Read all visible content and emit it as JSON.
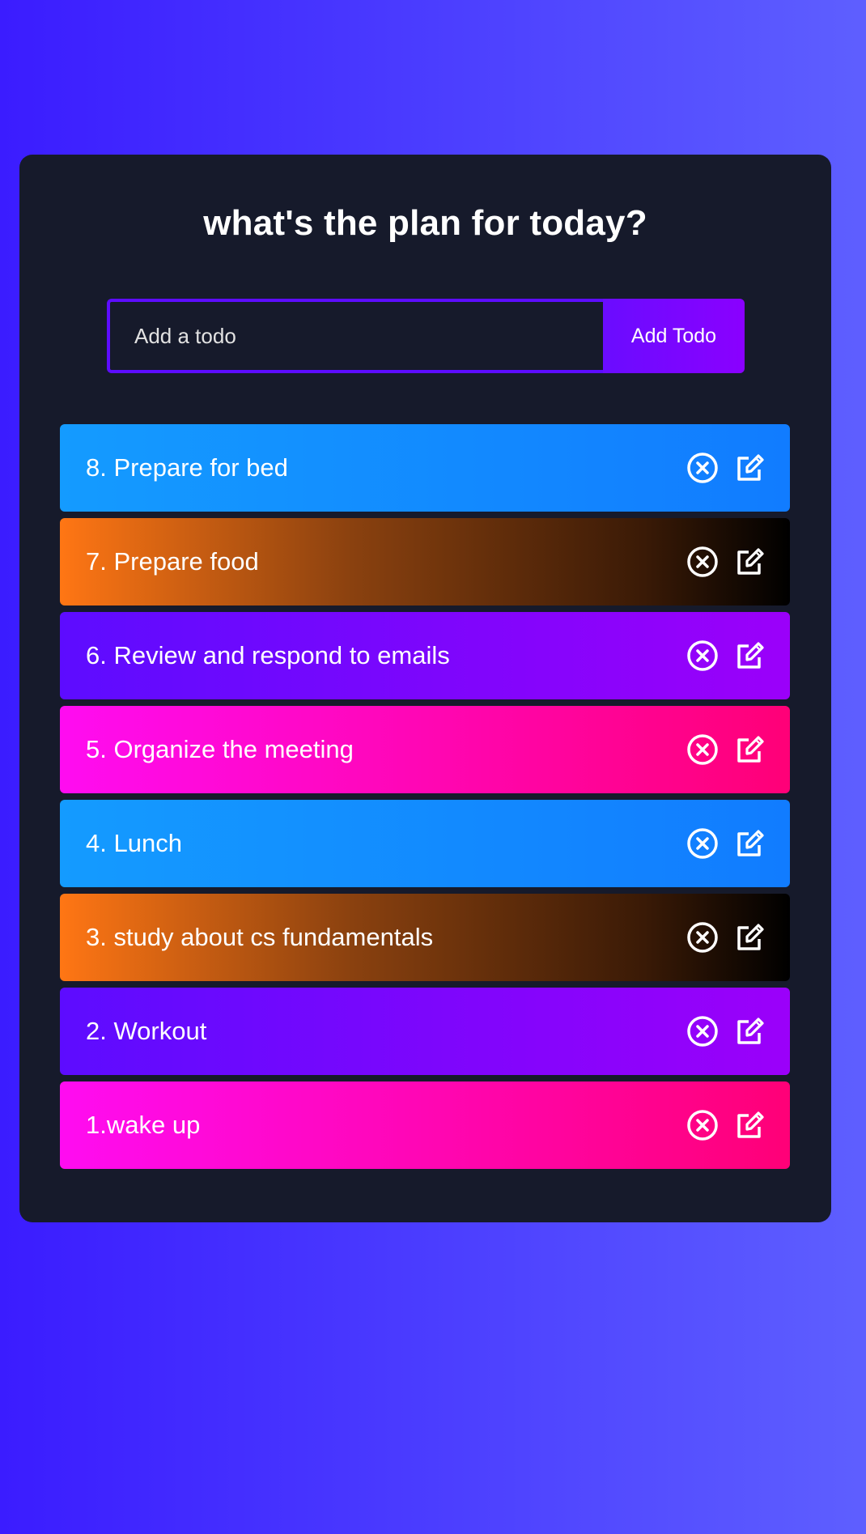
{
  "app": {
    "title": "what's the plan for today?"
  },
  "form": {
    "input_placeholder": "Add a todo",
    "input_value": "",
    "button_label": "Add Todo"
  },
  "todos": [
    {
      "text": "8. Prepare for bed",
      "theme": "blue"
    },
    {
      "text": "7. Prepare food",
      "theme": "orange"
    },
    {
      "text": "6. Review and respond to emails",
      "theme": "purple"
    },
    {
      "text": "5. Organize the meeting",
      "theme": "pink"
    },
    {
      "text": "4. Lunch",
      "theme": "blue"
    },
    {
      "text": "3. study about cs fundamentals",
      "theme": "orange"
    },
    {
      "text": "2. Workout",
      "theme": "purple"
    },
    {
      "text": "1.wake up",
      "theme": "pink"
    }
  ],
  "icons": {
    "delete": "close-circle-icon",
    "edit": "edit-icon"
  },
  "colors": {
    "background": "#3b1cff",
    "panel": "#161a2b",
    "accent": "#5d0cff"
  }
}
